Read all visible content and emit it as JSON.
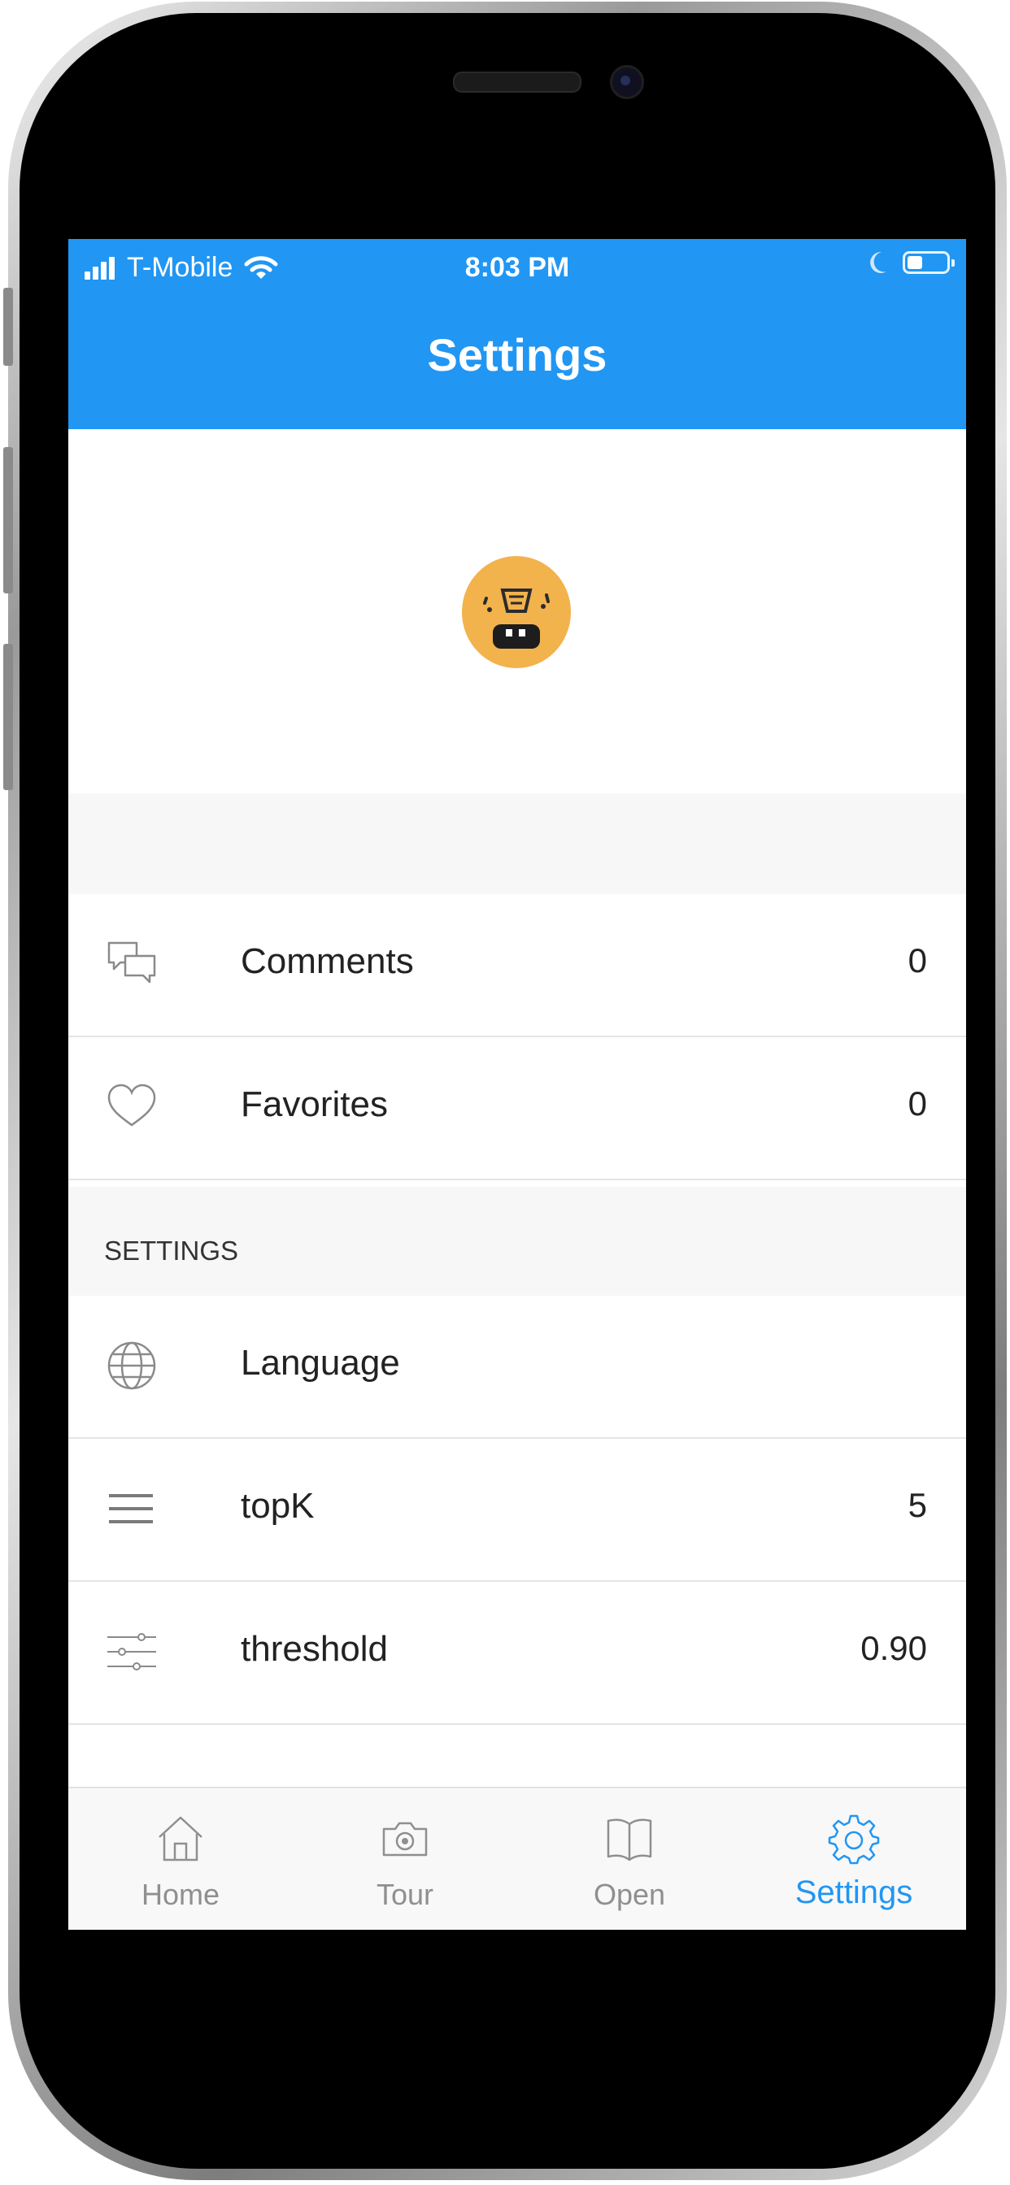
{
  "status_bar": {
    "carrier": "T-Mobile",
    "time": "8:03 PM",
    "icons": [
      "cellular-signal-icon",
      "wifi-icon",
      "moon-icon",
      "battery-icon"
    ]
  },
  "header": {
    "title": "Settings"
  },
  "profile": {
    "avatar_icon": "avatar-face-icon"
  },
  "stats": [
    {
      "label": "Comments",
      "value": "0",
      "icon": "comments-icon"
    },
    {
      "label": "Favorites",
      "value": "0",
      "icon": "heart-icon"
    }
  ],
  "settings_section": {
    "title": "SETTINGS",
    "items": [
      {
        "label": "Language",
        "value": "",
        "icon": "globe-icon"
      },
      {
        "label": "topK",
        "value": "5",
        "icon": "list-icon"
      },
      {
        "label": "threshold",
        "value": "0.90",
        "icon": "sliders-icon"
      }
    ]
  },
  "tab_bar": {
    "tabs": [
      {
        "label": "Home",
        "icon": "home-icon",
        "active": false
      },
      {
        "label": "Tour",
        "icon": "camera-icon",
        "active": false
      },
      {
        "label": "Open",
        "icon": "book-icon",
        "active": false
      },
      {
        "label": "Settings",
        "icon": "gear-icon",
        "active": true
      }
    ]
  },
  "colors": {
    "accent": "#2196f3",
    "avatar": "#f2b24c",
    "section_bg": "#f7f7f7",
    "inactive_tab": "#8f8f8f"
  }
}
